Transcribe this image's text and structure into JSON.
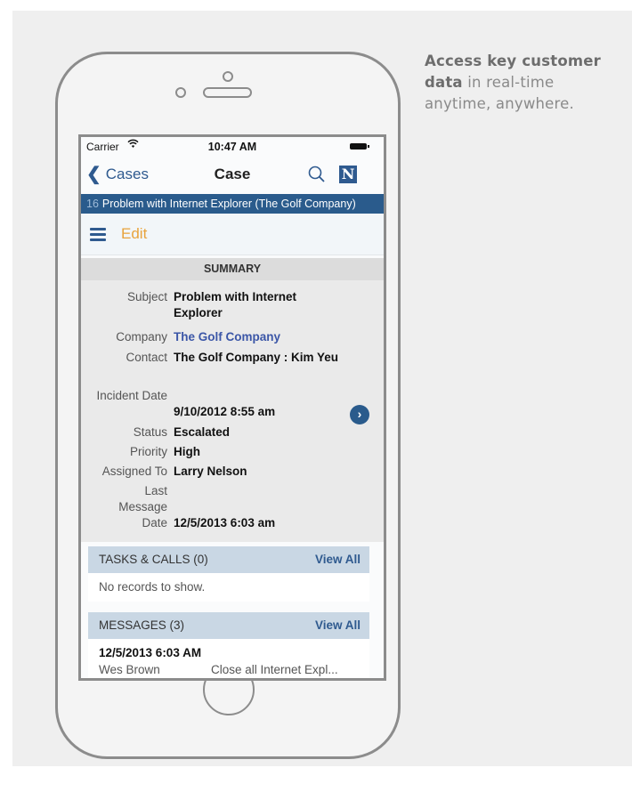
{
  "tagline": {
    "bold": "Access key customer data",
    "rest": " in real-time anytime, anywhere."
  },
  "statusbar": {
    "carrier": "Carrier",
    "time": "10:47 AM"
  },
  "navbar": {
    "back_label": "Cases",
    "title": "Case",
    "logo_letter": "N"
  },
  "record_bar": {
    "number": "16",
    "text": "Problem with Internet Explorer (The Golf Company)"
  },
  "actionbar": {
    "edit_label": "Edit"
  },
  "summary": {
    "header": "SUMMARY",
    "fields": [
      {
        "label": "Subject",
        "value": "Problem with Internet Explorer"
      },
      {
        "label": "Company",
        "value": "The Golf Company"
      },
      {
        "label": "Contact",
        "value": "The Golf Company : Kim Yeu"
      },
      {
        "label": "Incident Date",
        "value": "9/10/2012 8:55 am"
      },
      {
        "label": "Status",
        "value": "Escalated"
      },
      {
        "label": "Priority",
        "value": "High"
      },
      {
        "label": "Assigned To",
        "value": "Larry Nelson"
      },
      {
        "label": "Last Message Date",
        "value": "12/5/2013 6:03 am"
      }
    ]
  },
  "tasks": {
    "header": "TASKS & CALLS (0)",
    "view_all": "View All",
    "empty_text": "No records to show."
  },
  "messages": {
    "header": "MESSAGES (3)",
    "view_all": "View All",
    "first": {
      "date": "12/5/2013 6:03 AM",
      "author": "Wes Brown",
      "subject": "Close all Internet Expl..."
    }
  },
  "colors": {
    "accent": "#2a5b8c",
    "edit": "#e8a33c",
    "link": "#3b56a7"
  }
}
